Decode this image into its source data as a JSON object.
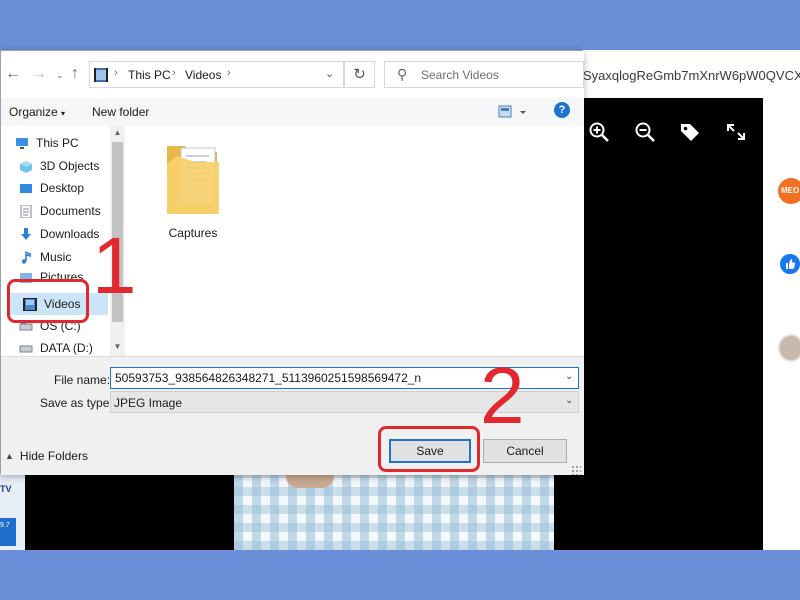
{
  "browser": {
    "url_fragment": "SyaxqlogReGmb7mXnrW6pW0QVCX",
    "side_badge": "MEO",
    "left_logo": "TV",
    "left_badge": "9.7"
  },
  "dialog": {
    "address": {
      "path": [
        "This PC",
        "Videos"
      ],
      "search_placeholder": "Search Videos",
      "refresh_icon": "↻"
    },
    "toolbar": {
      "organize": "Organize",
      "new_folder": "New folder",
      "help": "?"
    },
    "nav": {
      "items": [
        {
          "label": "This PC",
          "icon": "computer-icon"
        },
        {
          "label": "3D Objects",
          "icon": "cube-icon"
        },
        {
          "label": "Desktop",
          "icon": "desktop-icon"
        },
        {
          "label": "Documents",
          "icon": "document-icon"
        },
        {
          "label": "Downloads",
          "icon": "download-icon"
        },
        {
          "label": "Music",
          "icon": "music-icon"
        },
        {
          "label": "Pictures",
          "icon": "pictures-icon"
        },
        {
          "label": "Videos",
          "icon": "video-icon",
          "selected": true
        },
        {
          "label": "OS (C:)",
          "icon": "drive-icon"
        },
        {
          "label": "DATA (D:)",
          "icon": "drive-icon"
        }
      ]
    },
    "files": [
      {
        "name": "Captures",
        "type": "folder"
      }
    ],
    "form": {
      "filename_label": "File name:",
      "filename_value": "50593753_938564826348271_5113960251598569472_n",
      "type_label": "Save as type:",
      "type_value": "JPEG Image",
      "hide_folders": "Hide Folders",
      "save": "Save",
      "cancel": "Cancel"
    }
  },
  "annotations": {
    "step1": "1",
    "step2": "2"
  },
  "colors": {
    "frame": "#6a8fd8",
    "accent": "#1e73cf",
    "annotation": "#e0282e",
    "selection": "#cce4f7"
  }
}
